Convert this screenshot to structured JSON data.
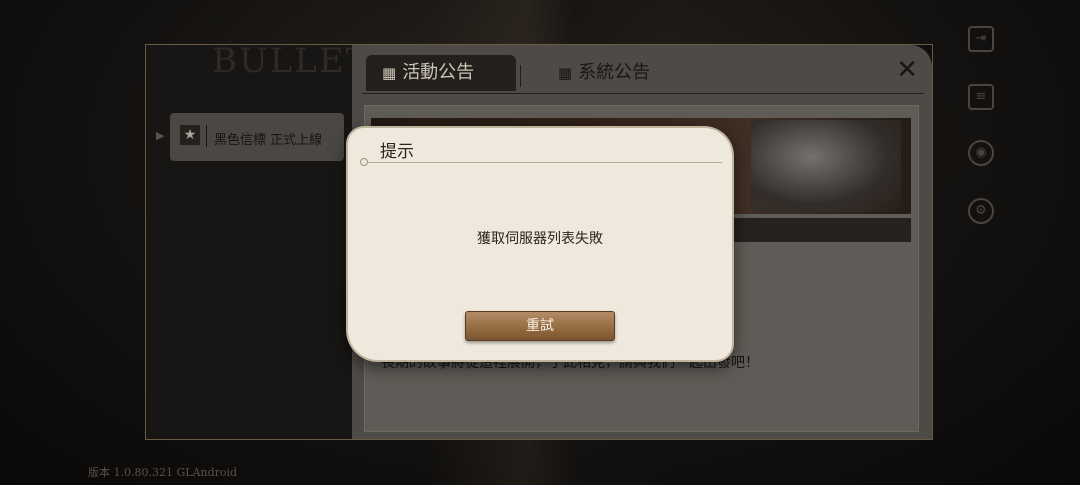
{
  "background": {
    "version_text": "版本 1.0.80.321 GLAndroid"
  },
  "panel": {
    "deco_title": "BULLET",
    "tabs": [
      {
        "label": "活動公告",
        "icon": "calendar-icon"
      },
      {
        "label": "系統公告",
        "icon": "calendar-gear-icon"
      }
    ],
    "list_items": [
      {
        "label": "黑色信標 正式上線",
        "icon": "star-icon"
      }
    ],
    "body_text": "長期的故事將從這裡展開，于此相見，請與我們一起出發吧！"
  },
  "right_rail": {
    "icons": [
      "exit-icon",
      "notice-icon",
      "camera-icon",
      "settings-icon"
    ]
  },
  "dialog": {
    "title": "提示",
    "message": "獲取伺服器列表失敗",
    "retry_label": "重試"
  },
  "colors": {
    "modal_bg": "#efe8dc",
    "button_brown": "#94693f",
    "panel_dark": "#1d1b1a"
  }
}
